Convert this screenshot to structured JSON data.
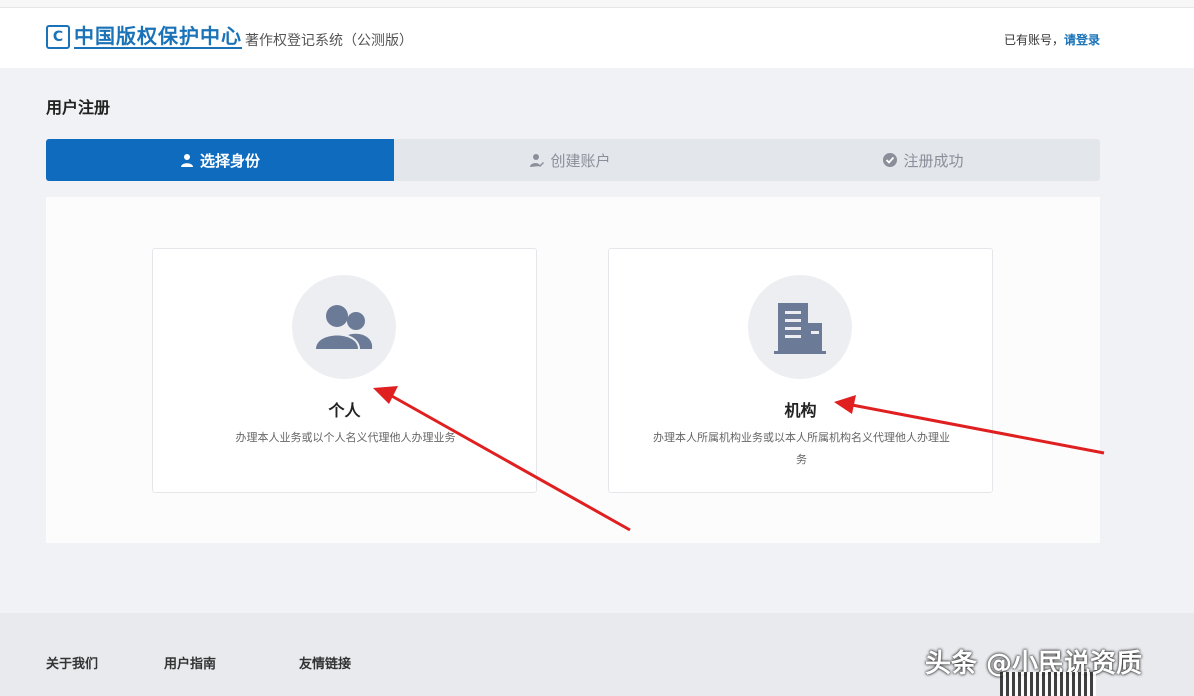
{
  "header": {
    "logo_text": "中国版权保护中心",
    "system_name": "著作权登记系统（公测版）",
    "login_prompt": "已有账号，",
    "login_link": "请登录"
  },
  "page": {
    "title": "用户注册"
  },
  "steps": [
    {
      "label": "选择身份",
      "icon": "user-icon",
      "active": true
    },
    {
      "label": "创建账户",
      "icon": "user-edit-icon",
      "active": false
    },
    {
      "label": "注册成功",
      "icon": "check-circle-icon",
      "active": false
    }
  ],
  "cards": {
    "personal": {
      "title": "个人",
      "desc": "办理本人业务或以个人名义代理他人办理业务",
      "icon": "people-icon"
    },
    "org": {
      "title": "机构",
      "desc": "办理本人所属机构业务或以本人所属机构名义代理他人办理业务",
      "icon": "building-icon"
    }
  },
  "footer": {
    "col1": "关于我们",
    "col2": "用户指南",
    "col3": "友情链接"
  },
  "watermark": "头条 @小民说资质",
  "colors": {
    "primary": "#0e6bbd",
    "annotation_arrow": "#e02020"
  }
}
